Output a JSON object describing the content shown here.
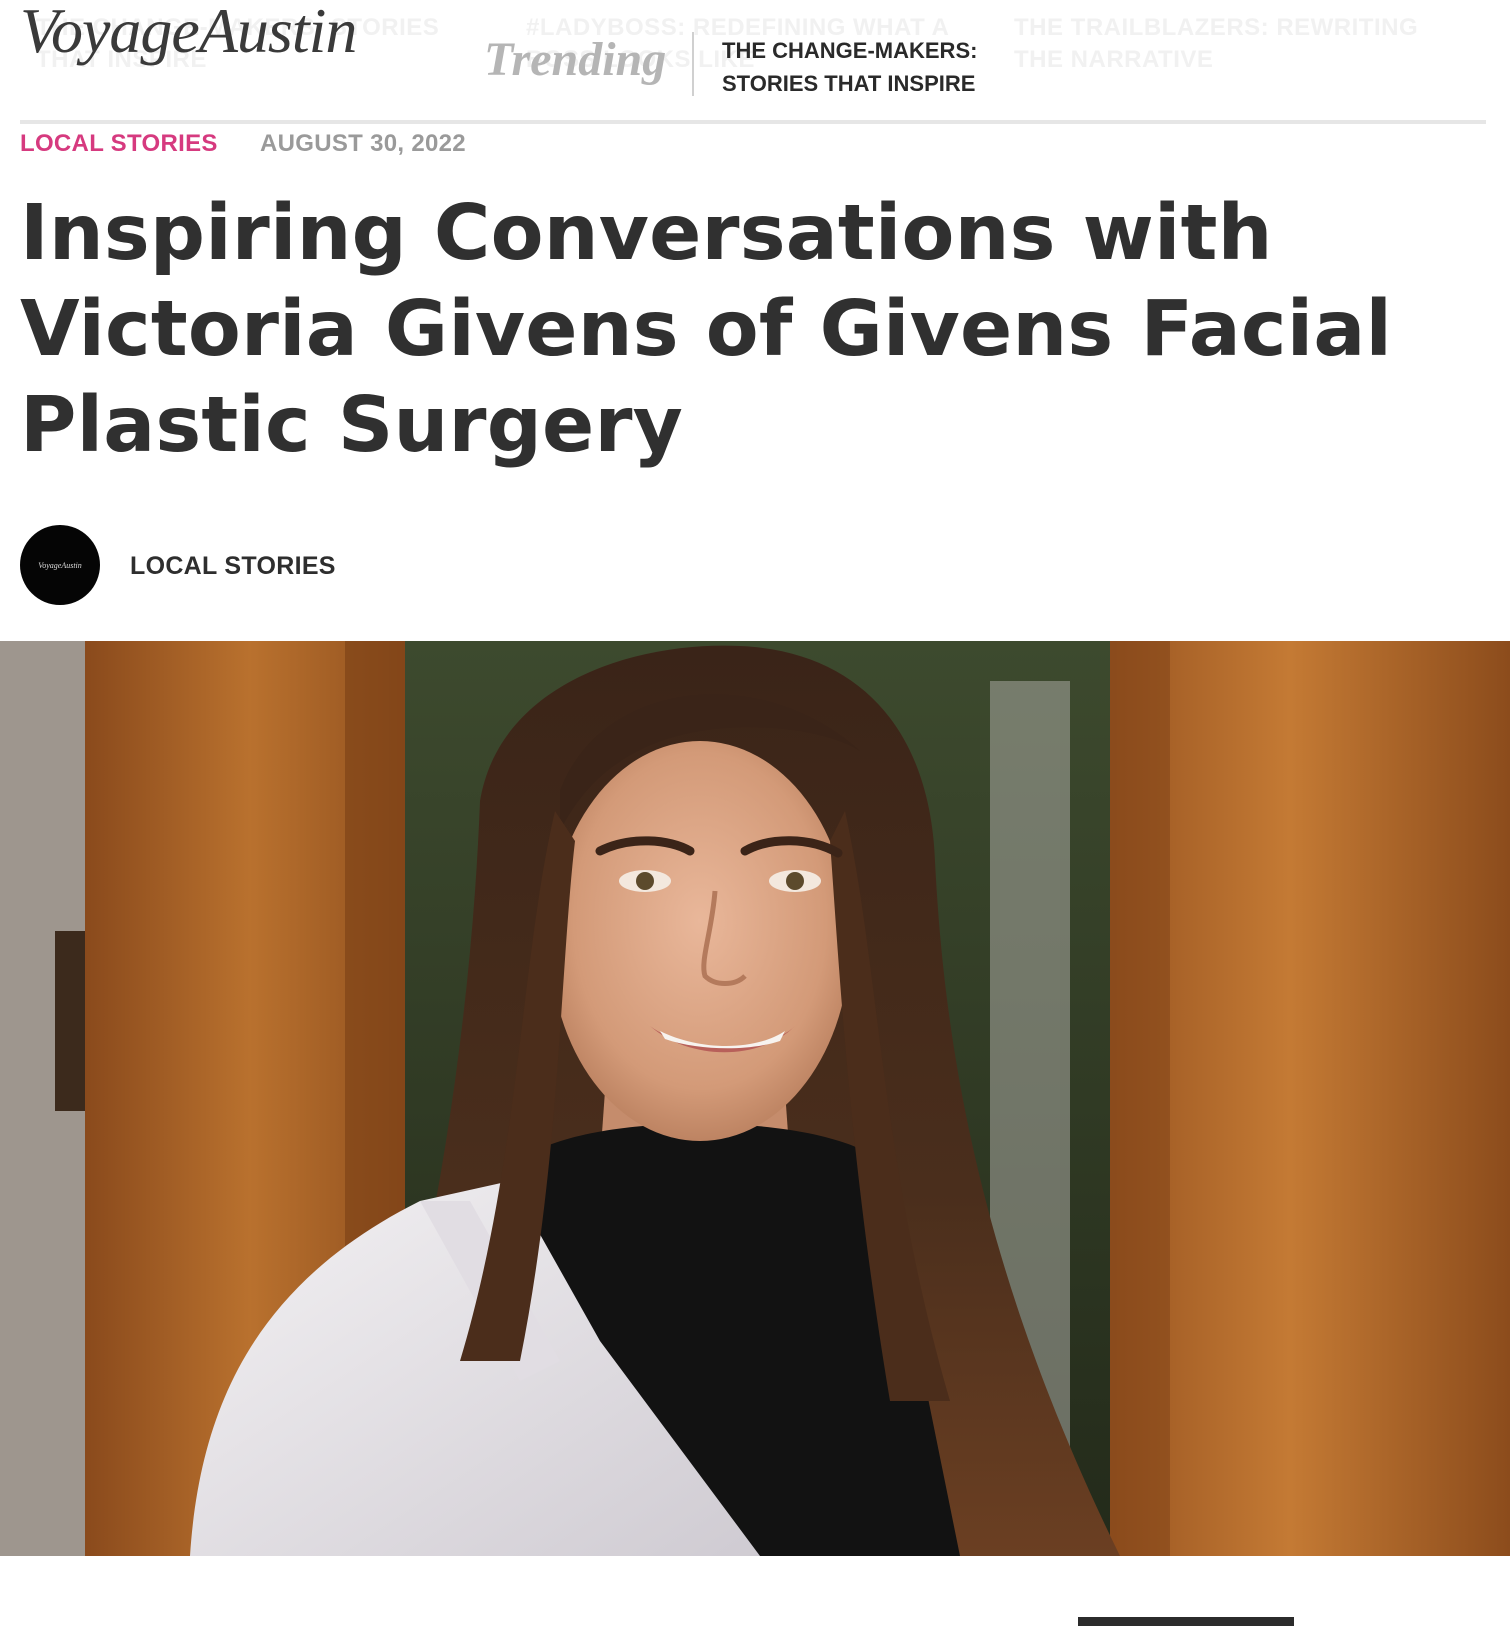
{
  "header": {
    "logo": "VoyageAustin",
    "trending_label": "Trending",
    "ticker": [
      {
        "line1": "THE CHANGE-MAKERS: STORIES",
        "line2": "THAT INSPIRE"
      },
      {
        "line1": "#LADYBOSS: REDEFINING WHAT A",
        "line2": "BOSS LOOKS LIKE"
      },
      {
        "line1": "THE TRAILBLAZERS: REWRITING",
        "line2": "THE NARRATIVE"
      }
    ],
    "trending_current": "THE CHANGE-MAKERS: STORIES THAT INSPIRE"
  },
  "article": {
    "category": "LOCAL STORIES",
    "date": "AUGUST 30, 2022",
    "title": "Inspiring Conversations with Victoria Givens of Givens Facial Plastic Surgery",
    "author": {
      "avatar_text": "VoyageAustin",
      "name": "LOCAL STORIES"
    }
  },
  "colors": {
    "category": "#d63a7f",
    "title": "#303030",
    "date": "#9a9a9a",
    "trending": "#b5b5b5"
  }
}
